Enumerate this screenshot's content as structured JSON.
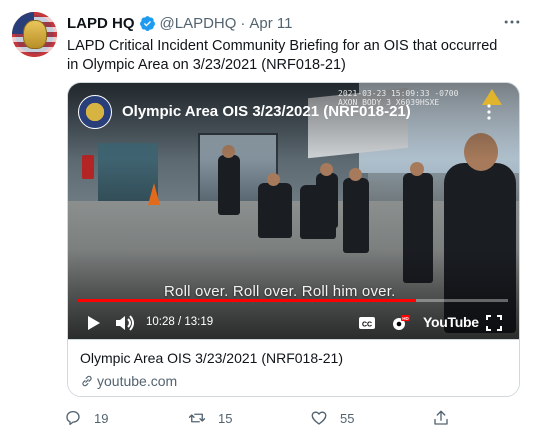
{
  "tweet": {
    "author_name": "LAPD HQ",
    "handle": "@LAPDHQ",
    "separator": "·",
    "timestamp": "Apr 11",
    "text": "LAPD Critical Incident Community Briefing for an OIS that occurred in Olympic Area on 3/23/2021 (NRF018-21)",
    "verified": true
  },
  "card": {
    "video": {
      "title": "Olympic Area OIS 3/23/2021 (NRF018-21)",
      "subtitle": "Roll over. Roll over. Roll him over.",
      "time_display": "10:28 / 13:19",
      "progress_fraction": 0.786,
      "bodycam_timestamp_line1": "2021-03-23 15:09:33 -0700",
      "bodycam_timestamp_line2": "AXON BODY 3 X6039HSXE",
      "brand_label": "YouTube"
    },
    "title": "Olympic Area OIS 3/23/2021 (NRF018-21)",
    "domain": "youtube.com"
  },
  "actions": {
    "reply_count": "19",
    "retweet_count": "15",
    "like_count": "55"
  },
  "colors": {
    "verified_blue": "#1d9bf0",
    "secondary_text": "#536471",
    "progress_red": "#ff0000",
    "border": "#cfd9de"
  },
  "icons": [
    "verified-icon",
    "more-icon",
    "play-icon",
    "volume-icon",
    "cc-icon",
    "settings-hd-icon",
    "fullscreen-icon",
    "link-icon",
    "reply-icon",
    "retweet-icon",
    "like-icon",
    "share-icon"
  ]
}
